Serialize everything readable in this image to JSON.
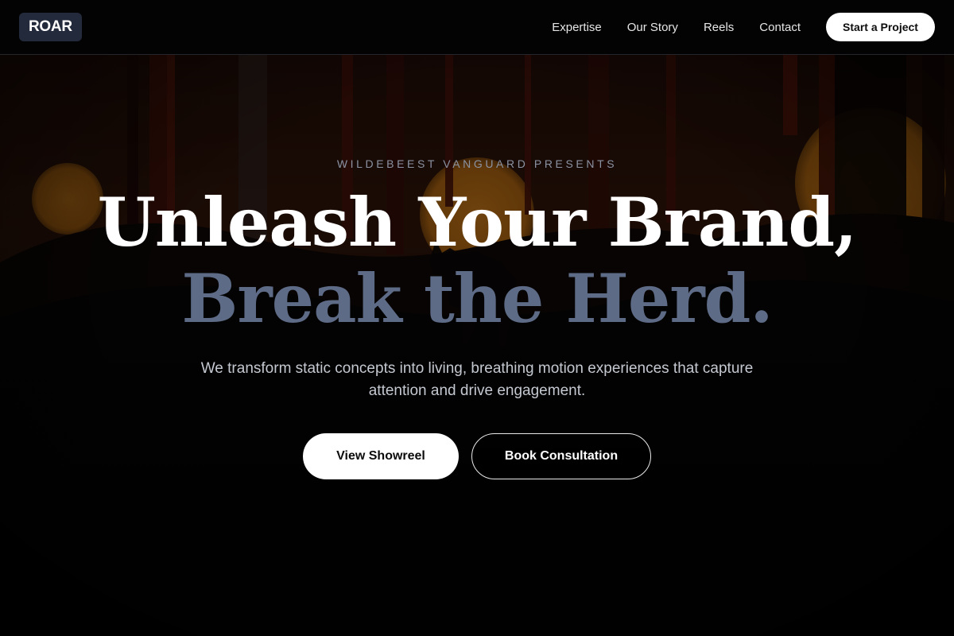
{
  "brand": {
    "logo_text": "ROAR",
    "accent": "#232a3b"
  },
  "nav": {
    "links": [
      "Expertise",
      "Our Story",
      "Reels",
      "Contact"
    ],
    "cta_label": "Start a Project"
  },
  "hero": {
    "eyebrow": "WILDEBEEST VANGUARD PRESENTS",
    "headline_line1": "Unleash Your Brand,",
    "headline_line2": "Break the Herd.",
    "subtitle": "We transform static concepts into living, breathing motion experiences that capture attention and drive engagement.",
    "primary_button": "View Showreel",
    "secondary_button": "Book Consultation"
  },
  "colors": {
    "background": "#030303",
    "headline_primary": "#ffffff",
    "headline_secondary": "#5d6b86",
    "sun": "#c97a16",
    "forest_shadow": "#160805"
  }
}
